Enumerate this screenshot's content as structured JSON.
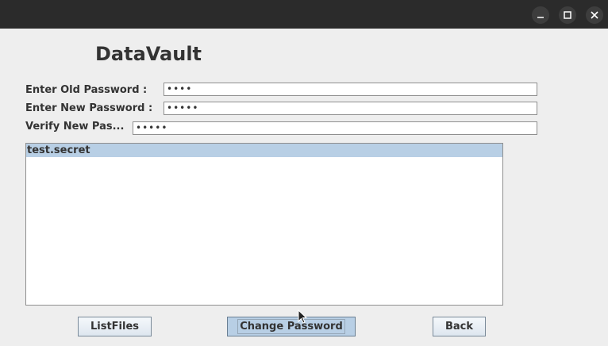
{
  "app": {
    "title": "DataVault"
  },
  "window_controls": {
    "minimize_icon": "minimize-icon",
    "maximize_icon": "maximize-icon",
    "close_icon": "close-icon"
  },
  "form": {
    "old_password": {
      "label": "Enter Old Password :",
      "value": "••••"
    },
    "new_password": {
      "label": "Enter New Password :",
      "value": "•••••"
    },
    "verify_password": {
      "label": "Verify New Pas...",
      "value": "•••••"
    }
  },
  "file_list": {
    "items": [
      {
        "name": "test.secret",
        "selected": true
      }
    ]
  },
  "buttons": {
    "list_files": "ListFiles",
    "change_password": "Change Password",
    "back": "Back"
  },
  "colors": {
    "titlebar": "#2b2b2b",
    "background": "#eeeeee",
    "selection": "#b8cfe5"
  }
}
